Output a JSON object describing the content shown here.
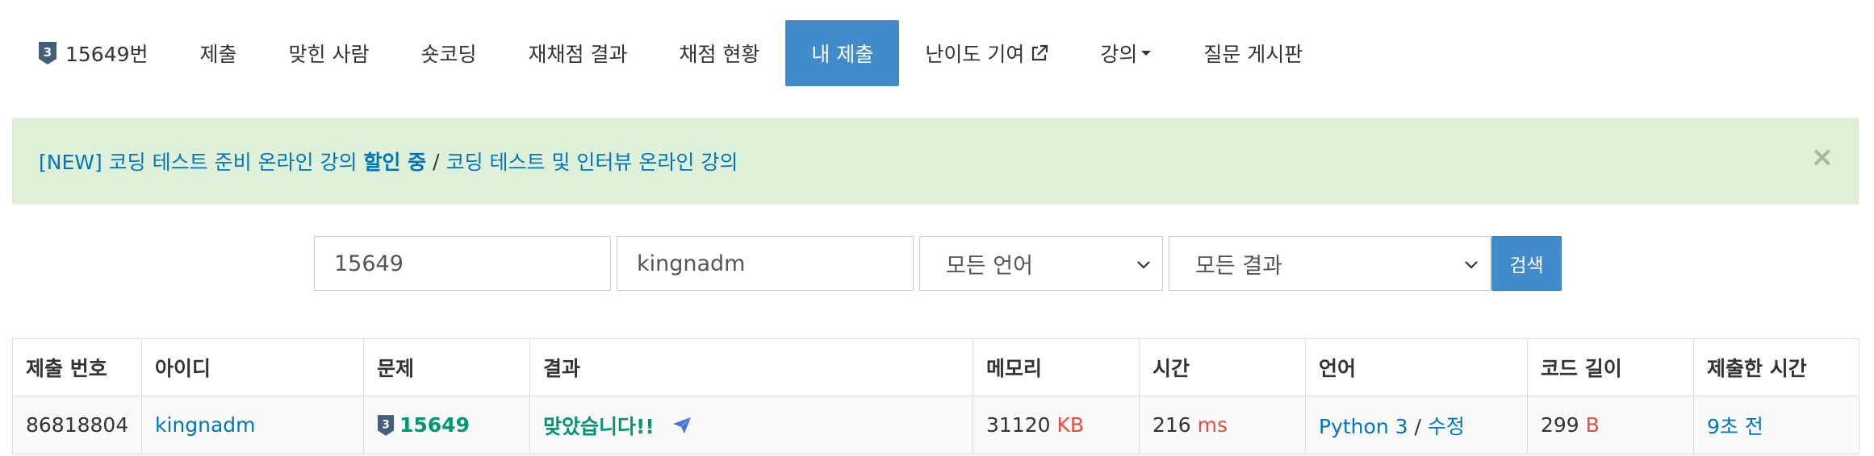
{
  "nav": {
    "problem_id": "15649번",
    "problem_tier": "3",
    "items": [
      "제출",
      "맞힌 사람",
      "숏코딩",
      "재채점 결과",
      "채점 현황",
      "내 제출",
      "난이도 기여",
      "강의",
      "질문 게시판"
    ]
  },
  "alert": {
    "prefix": "[NEW] 코딩 테스트 준비 온라인 강의",
    "highlight": "할인 중",
    "separator": "/",
    "link2": "코딩 테스트 및 인터뷰 온라인 강의",
    "close": "×"
  },
  "search": {
    "problem_value": "15649",
    "user_value": "kingnadm",
    "language_selected": "모든 언어",
    "result_selected": "모든 결과",
    "button_label": "검색"
  },
  "table": {
    "headers": [
      "제출 번호",
      "아이디",
      "문제",
      "결과",
      "메모리",
      "시간",
      "언어",
      "코드 길이",
      "제출한 시간"
    ],
    "row": {
      "submission_id": "86818804",
      "user": "kingnadm",
      "problem": "15649",
      "problem_tier": "3",
      "result": "맞았습니다!!",
      "memory": "31120",
      "memory_unit": "KB",
      "time": "216",
      "time_unit": "ms",
      "language": "Python 3",
      "lang_sep": "/",
      "edit": "수정",
      "code_length": "299",
      "code_length_unit": "B",
      "submitted": "9초 전"
    }
  },
  "colors": {
    "primary": "#428bca",
    "link": "#0076c0",
    "accepted": "#009874",
    "unit": "#e74c3c",
    "alert_bg": "#dff0d8"
  },
  "icons": {
    "tier": "silver-tier-badge-icon",
    "external": "external-link-icon",
    "caret": "caret-down-icon",
    "share": "paper-plane-icon",
    "select": "chevron-down-icon"
  }
}
